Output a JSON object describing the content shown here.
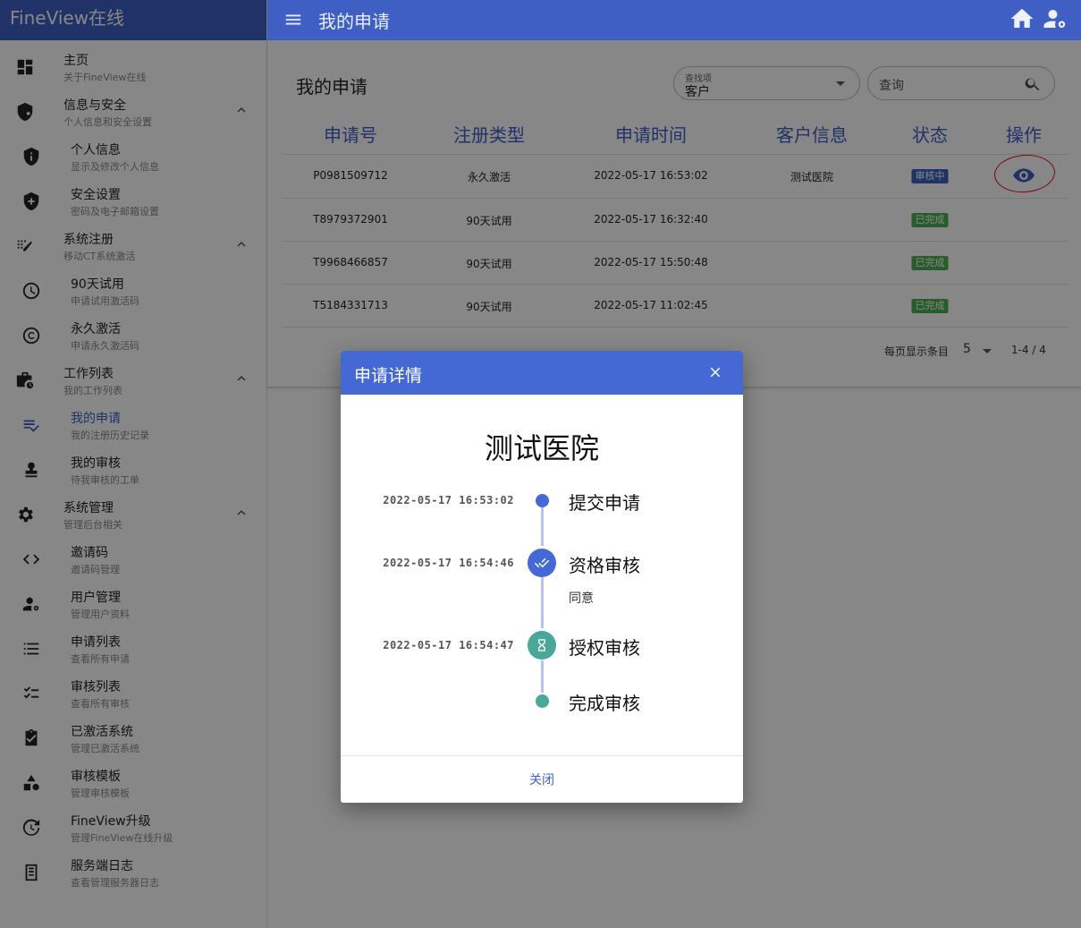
{
  "app": {
    "brand": "FineView在线",
    "header_title": "我的申请"
  },
  "sidebar": {
    "items": [
      {
        "label": "主页",
        "desc": "关于FineView在线",
        "icon": "dashboard-icon"
      },
      {
        "label": "信息与安全",
        "desc": "个人信息和安全设置",
        "icon": "shield-account-icon"
      },
      {
        "label": "个人信息",
        "desc": "显示及修改个人信息",
        "icon": "shield-info-icon"
      },
      {
        "label": "安全设置",
        "desc": "密码及电子邮箱设置",
        "icon": "shield-plus-icon"
      },
      {
        "label": "系统注册",
        "desc": "移动CT系统激活",
        "icon": "register-icon"
      },
      {
        "label": "90天试用",
        "desc": "申请试用激活码",
        "icon": "clock-icon"
      },
      {
        "label": "永久激活",
        "desc": "申请永久激活码",
        "icon": "copyright-icon"
      },
      {
        "label": "工作列表",
        "desc": "我的工作列表",
        "icon": "briefcase-clock-icon"
      },
      {
        "label": "我的申请",
        "desc": "我的注册历史记录",
        "icon": "list-check-icon"
      },
      {
        "label": "我的审核",
        "desc": "待我审核的工单",
        "icon": "stamp-icon"
      },
      {
        "label": "系统管理",
        "desc": "管理后台相关",
        "icon": "gear-icon"
      },
      {
        "label": "邀请码",
        "desc": "邀请码管理",
        "icon": "code-icon"
      },
      {
        "label": "用户管理",
        "desc": "管理用户资料",
        "icon": "user-gear-icon"
      },
      {
        "label": "申请列表",
        "desc": "查看所有申请",
        "icon": "list-icon"
      },
      {
        "label": "审核列表",
        "desc": "查看所有审核",
        "icon": "checklist-icon"
      },
      {
        "label": "已激活系统",
        "desc": "管理已激活系统",
        "icon": "clipboard-check-icon"
      },
      {
        "label": "审核模板",
        "desc": "管理审核模板",
        "icon": "shapes-icon"
      },
      {
        "label": "FineView升级",
        "desc": "管理FineView在线升级",
        "icon": "update-icon"
      },
      {
        "label": "服务端日志",
        "desc": "查看管理服务器日志",
        "icon": "log-icon"
      }
    ]
  },
  "main": {
    "title": "我的申请",
    "search": {
      "label": "查找项",
      "value": "客户",
      "query_placeholder": "查询"
    },
    "columns": [
      "申请号",
      "注册类型",
      "申请时间",
      "客户信息",
      "状态",
      "操作"
    ],
    "rows": [
      {
        "id": "P0981509712",
        "type": "永久激活",
        "time": "2022-05-17 16:53:02",
        "customer": "测试医院",
        "status": "审核中"
      },
      {
        "id": "T8979372901",
        "type": "90天试用",
        "time": "2022-05-17 16:32:40",
        "customer": "",
        "status": "已完成"
      },
      {
        "id": "T9968466857",
        "type": "90天试用",
        "time": "2022-05-17 15:50:48",
        "customer": "",
        "status": "已完成"
      },
      {
        "id": "T5184331713",
        "type": "90天试用",
        "time": "2022-05-17 11:02:45",
        "customer": "",
        "status": "已完成"
      }
    ],
    "pager": {
      "label": "每页显示条目",
      "size": "5",
      "range": "1-4 / 4"
    }
  },
  "dialog": {
    "title": "申请详情",
    "hospital": "测试医院",
    "timeline": [
      {
        "time": "2022-05-17 16:53:02",
        "title": "提交申请",
        "note": ""
      },
      {
        "time": "2022-05-17 16:54:46",
        "title": "资格审核",
        "note": "同意"
      },
      {
        "time": "2022-05-17 16:54:47",
        "title": "授权审核",
        "note": ""
      },
      {
        "time": "",
        "title": "完成审核",
        "note": ""
      }
    ],
    "close_label": "关闭"
  },
  "colors": {
    "primary": "#3f5fc4",
    "dialog_header": "#4569d4",
    "teal": "#4aa79a",
    "done": "#4caf50",
    "annotation": "#e01818"
  }
}
